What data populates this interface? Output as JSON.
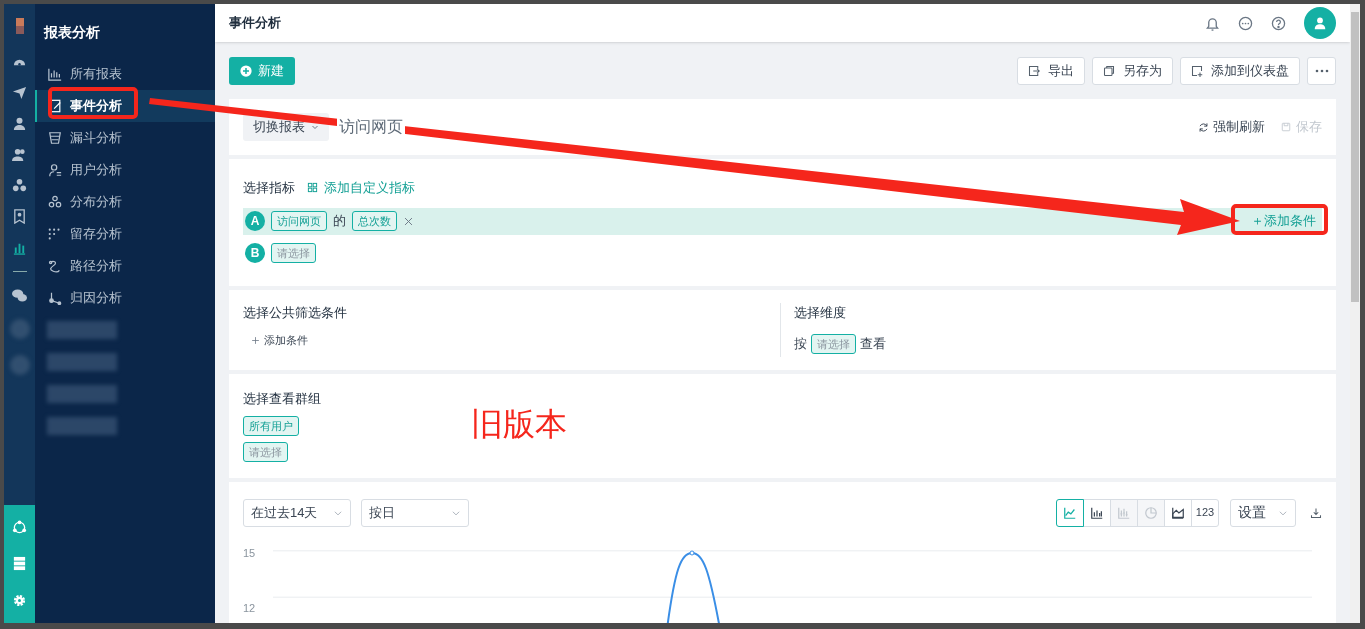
{
  "rail": {
    "top": [
      {
        "kind": "logo"
      },
      {
        "kind": "dashboard",
        "selected": false
      },
      {
        "kind": "send",
        "selected": false
      },
      {
        "kind": "user",
        "selected": false
      },
      {
        "kind": "users",
        "selected": false
      },
      {
        "kind": "cubes",
        "selected": false
      },
      {
        "kind": "bookmark",
        "selected": false
      },
      {
        "kind": "chart",
        "selected": true
      },
      {
        "kind": "divider"
      },
      {
        "kind": "chat",
        "selected": false
      },
      {
        "kind": "blurred"
      },
      {
        "kind": "blurred"
      }
    ],
    "bottom": [
      {
        "kind": "hub"
      },
      {
        "kind": "server"
      },
      {
        "kind": "gear"
      }
    ]
  },
  "sidebar": {
    "title": "报表分析",
    "items": [
      {
        "kind": "link",
        "label": "所有报表",
        "selected": false
      },
      {
        "kind": "link",
        "label": "事件分析",
        "selected": true
      },
      {
        "kind": "link",
        "label": "漏斗分析",
        "selected": false
      },
      {
        "kind": "link",
        "label": "用户分析",
        "selected": false
      },
      {
        "kind": "link",
        "label": "分布分析",
        "selected": false
      },
      {
        "kind": "link",
        "label": "留存分析",
        "selected": false
      },
      {
        "kind": "link",
        "label": "路径分析",
        "selected": false
      },
      {
        "kind": "link",
        "label": "归因分析",
        "selected": false
      },
      {
        "kind": "blurred"
      },
      {
        "kind": "blurred"
      },
      {
        "kind": "blurred"
      },
      {
        "kind": "blurred"
      }
    ]
  },
  "header": {
    "title": "事件分析"
  },
  "toolbar": {
    "new_button": "新建",
    "actions": [
      {
        "label": "导出"
      },
      {
        "label": "另存为"
      },
      {
        "label": "添加到仪表盘"
      }
    ]
  },
  "report_bar": {
    "switch": "切换报表",
    "report_name": "访问网页",
    "refresh": "强制刷新",
    "save": {
      "label": "保存",
      "disabled": true
    }
  },
  "metrics": {
    "title": "选择指标",
    "custom": "添加自定义指标",
    "rows": [
      {
        "letter": "A",
        "event": "访问网页",
        "connector": "的",
        "measure": "总次数",
        "highlighted": true,
        "add_condition": "＋添加条件"
      },
      {
        "letter": "B",
        "placeholder": "请选择",
        "highlighted": false
      }
    ]
  },
  "filters": {
    "title": "选择公共筛选条件",
    "add": "添加条件"
  },
  "dimension": {
    "title": "选择维度",
    "prefix": "按",
    "placeholder": "请选择",
    "suffix": "查看"
  },
  "groups": {
    "title": "选择查看群组",
    "tags": [
      {
        "label": "所有用户",
        "kind": "value"
      },
      {
        "label": "请选择",
        "kind": "placeholder"
      }
    ]
  },
  "chart_toolbar": {
    "date": "在过去14天",
    "interval": "按日",
    "types": [
      {
        "kind": "line",
        "selected": true,
        "disabled": false
      },
      {
        "kind": "bar",
        "selected": false,
        "disabled": false
      },
      {
        "kind": "stacked",
        "selected": false,
        "disabled": true
      },
      {
        "kind": "pie",
        "selected": false,
        "disabled": true
      },
      {
        "kind": "area",
        "selected": false,
        "disabled": false
      },
      {
        "kind": "number",
        "label": "123",
        "selected": false,
        "disabled": false
      }
    ],
    "settings": "设置"
  },
  "chart": {
    "yticks": [
      "15",
      "12"
    ]
  },
  "annotation": {
    "text": "旧版本"
  }
}
